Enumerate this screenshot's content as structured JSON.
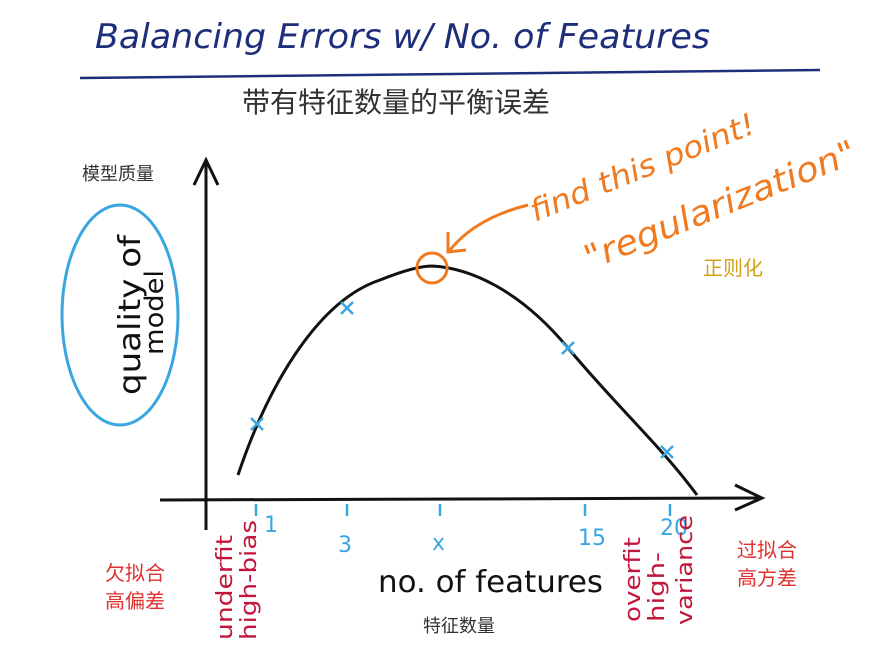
{
  "title_en": "Balancing Errors w/ No. of Features",
  "title_cn": "带有特征数量的平衡误差",
  "y_label_cn": "模型质量",
  "y_label_hand_line1": "quality of",
  "y_label_hand_line2": "model",
  "annotation_find": "find this point!",
  "annotation_regularization": "\"regularization\"",
  "regularization_cn": "正则化",
  "x_label_hand": "no. of features",
  "x_label_cn": "特征数量",
  "underfit_line1": "underfit",
  "underfit_line2": "high-bias",
  "underfit_cn_line1": "欠拟合",
  "underfit_cn_line2": "高偏差",
  "overfit_line1": "overfit",
  "overfit_line2": "high-",
  "overfit_line3": "variance",
  "overfit_cn_line1": "过拟合",
  "overfit_cn_line2": "高方差",
  "ticks": [
    "1",
    "3",
    "x",
    "15",
    "20"
  ],
  "colors": {
    "title": "#1f2e7a",
    "axis": "#111111",
    "blue_marks": "#3aa6e0",
    "orange": "#f07a20",
    "red_hand": "#c2163c",
    "cn_red": "#e03030",
    "cn_gold": "#d4a017",
    "cn_gray": "#333333"
  }
}
